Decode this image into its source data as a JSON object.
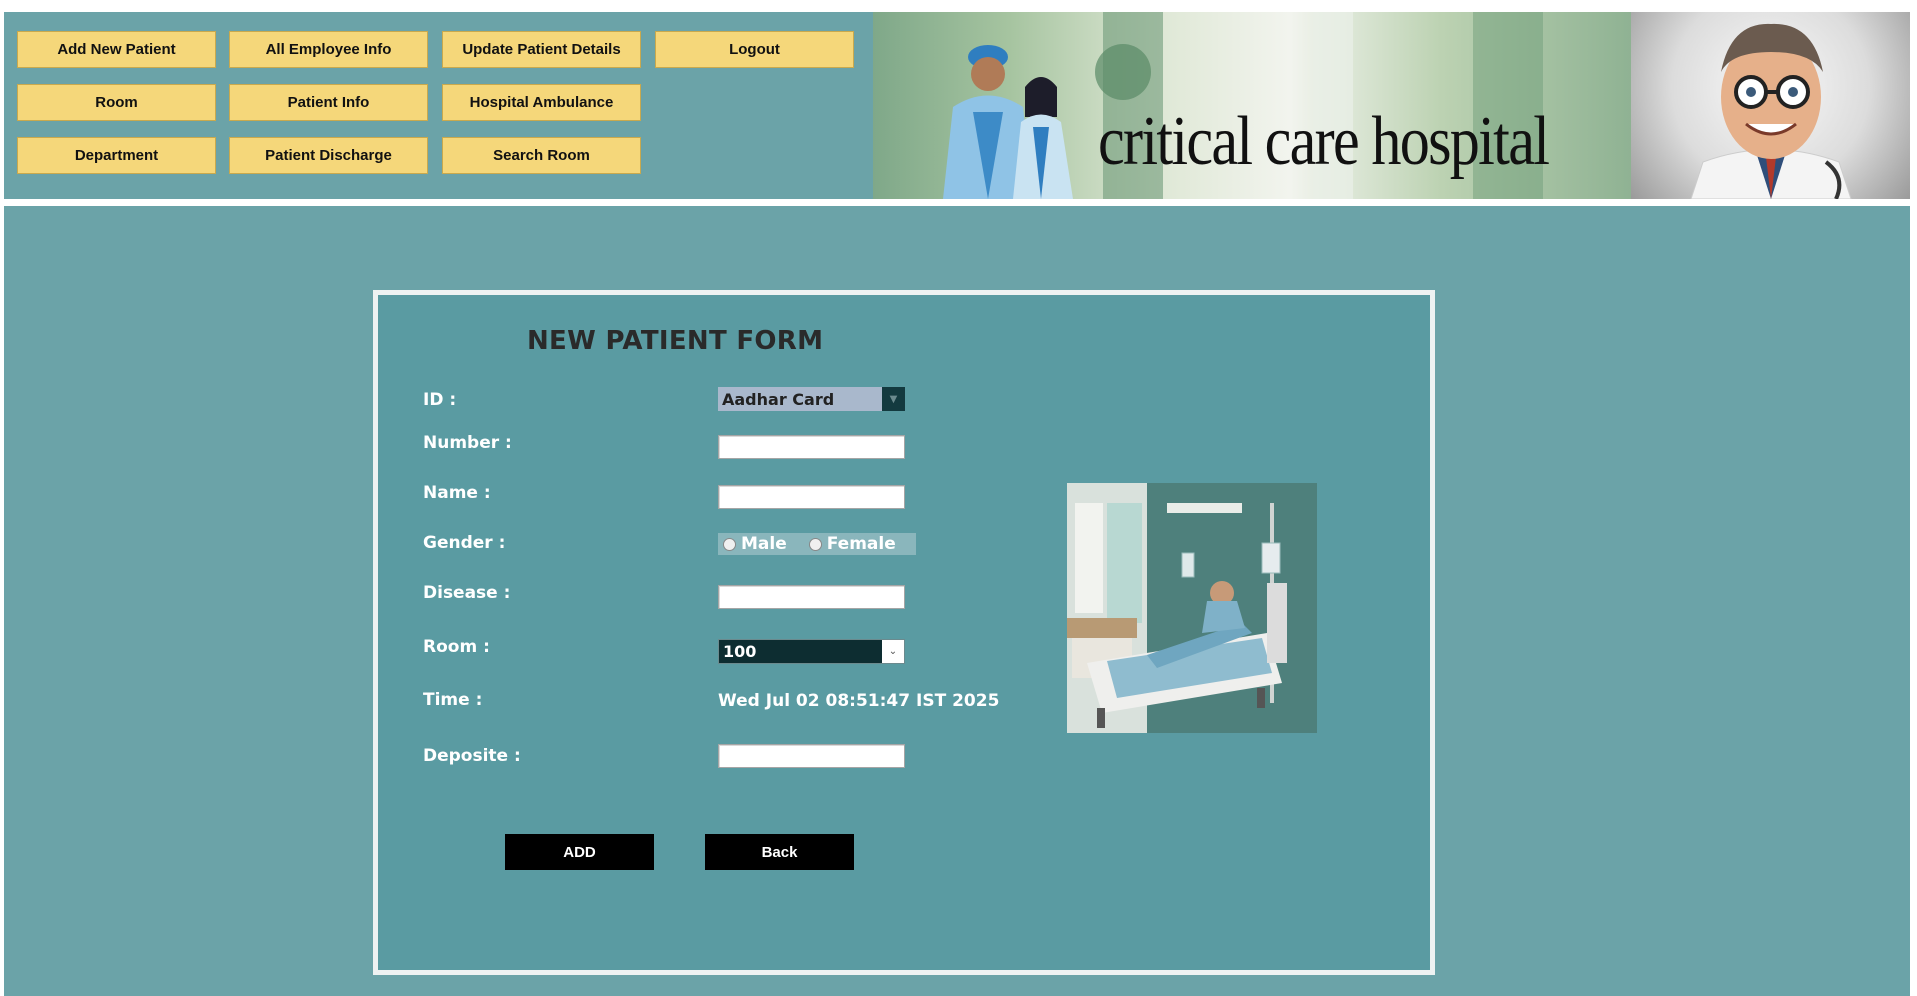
{
  "header": {
    "menu": [
      {
        "id": "add-new-patient",
        "label": "Add New Patient"
      },
      {
        "id": "all-employee-info",
        "label": "All Employee Info"
      },
      {
        "id": "update-patient-details",
        "label": "Update Patient Details"
      },
      {
        "id": "logout",
        "label": "Logout"
      },
      {
        "id": "room",
        "label": "Room"
      },
      {
        "id": "patient-info",
        "label": "Patient Info"
      },
      {
        "id": "hospital-ambulance",
        "label": "Hospital Ambulance"
      },
      {
        "id": "department",
        "label": "Department"
      },
      {
        "id": "patient-discharge",
        "label": "Patient Discharge"
      },
      {
        "id": "search-room",
        "label": "Search Room"
      }
    ],
    "banner_title": "critical care hospital"
  },
  "form": {
    "title": "NEW PATIENT FORM",
    "labels": {
      "id": "ID :",
      "number": "Number :",
      "name": "Name :",
      "gender": "Gender :",
      "disease": "Disease :",
      "room": "Room :",
      "time": "Time :",
      "deposite": "Deposite :"
    },
    "id_selected": "Aadhar Card",
    "gender_options": [
      "Male",
      "Female"
    ],
    "room_selected": "100",
    "time_value": "Wed Jul 02 08:51:47 IST 2025",
    "add_label": "ADD",
    "back_label": "Back"
  },
  "colors": {
    "panel": "#6ba3a8",
    "form_bg": "#5a9ba2",
    "menu_button": "#f5d77a",
    "action_button": "#000000"
  }
}
